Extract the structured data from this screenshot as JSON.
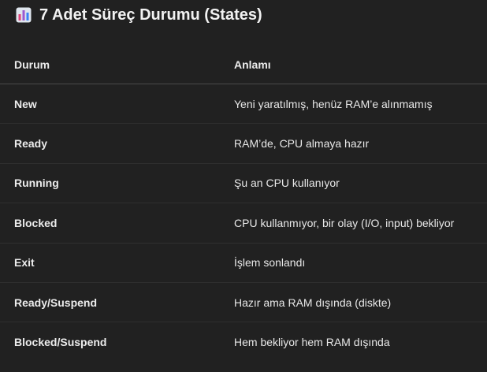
{
  "heading": {
    "icon": "bar-chart-icon",
    "text": "7 Adet Süreç Durumu (States)"
  },
  "table": {
    "headers": [
      "Durum",
      "Anlamı"
    ],
    "rows": [
      {
        "state": "New",
        "meaning": "Yeni yaratılmış, henüz RAM’e alınmamış"
      },
      {
        "state": "Ready",
        "meaning": "RAM’de, CPU almaya hazır"
      },
      {
        "state": "Running",
        "meaning": "Şu an CPU kullanıyor"
      },
      {
        "state": "Blocked",
        "meaning": "CPU kullanmıyor, bir olay (I/O, input) bekliyor"
      },
      {
        "state": "Exit",
        "meaning": "İşlem sonlandı"
      },
      {
        "state": "Ready/Suspend",
        "meaning": "Hazır ama RAM dışında (diskte)"
      },
      {
        "state": "Blocked/Suspend",
        "meaning": "Hem bekliyor hem RAM dışında"
      }
    ]
  },
  "colors": {
    "background": "#212121",
    "text": "#ececec",
    "icon_frame": "#dfe6ee",
    "icon_bar_pink": "#e0457b",
    "icon_bar_purple": "#9b59d0",
    "icon_bar_blue": "#3b82f6"
  }
}
